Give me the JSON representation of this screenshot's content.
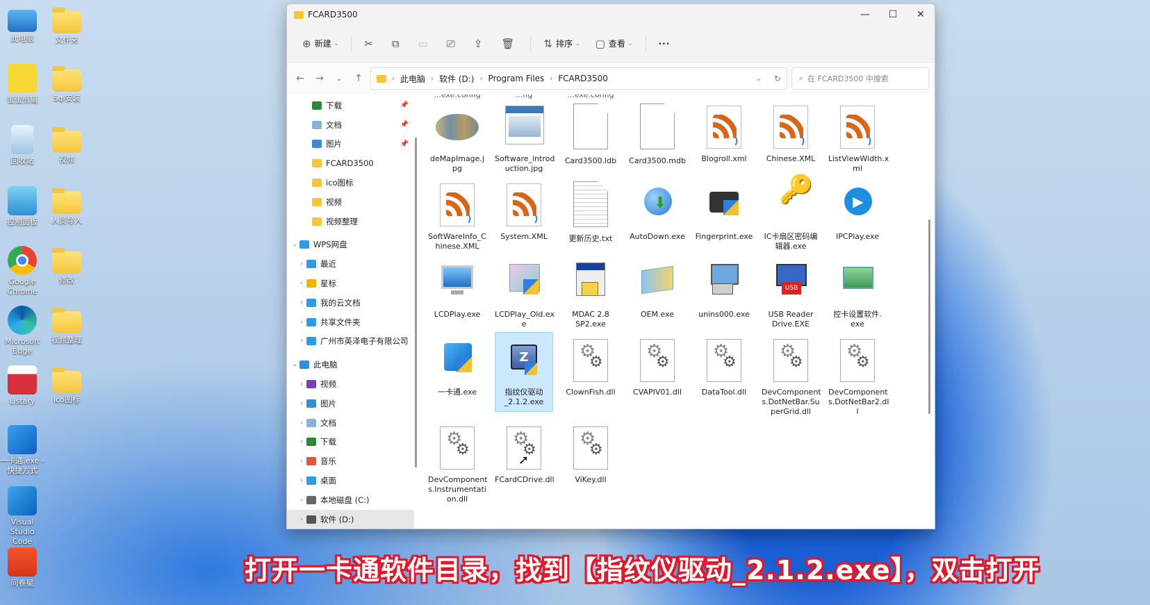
{
  "desktop": {
    "icons": [
      {
        "label": "此电脑"
      },
      {
        "label": "文件夹"
      },
      {
        "label": "蛋蛋剪辑"
      },
      {
        "label": "Sql安装"
      },
      {
        "label": "回收站"
      },
      {
        "label": "视频"
      },
      {
        "label": "控制面板"
      },
      {
        "label": "人员导入"
      },
      {
        "label": "Google Chrome"
      },
      {
        "label": "修改"
      },
      {
        "label": "Microsoft Edge"
      },
      {
        "label": "视频整理"
      },
      {
        "label": "Listary"
      },
      {
        "label": "ico图标"
      },
      {
        "label": "一卡通.exe - 快捷方式"
      },
      {
        "label": "Visual Studio Code"
      },
      {
        "label": "问卷星"
      }
    ]
  },
  "window": {
    "title": "FCARD3500",
    "controls": {
      "minimize": "—",
      "maximize": "☐",
      "close": "✕"
    }
  },
  "toolbar": {
    "new_label": "新建",
    "sort_label": "排序",
    "view_label": "查看",
    "more_label": "···"
  },
  "address": {
    "crumbs": [
      "此电脑",
      "软件 (D:)",
      "Program Files",
      "FCARD3500"
    ]
  },
  "search": {
    "placeholder": "在 FCARD3500 中搜索"
  },
  "sidebar": {
    "items": [
      {
        "label": "下载"
      },
      {
        "label": "文档"
      },
      {
        "label": "图片"
      },
      {
        "label": "FCARD3500"
      },
      {
        "label": "ico图标"
      },
      {
        "label": "视频"
      },
      {
        "label": "视频整理"
      },
      {
        "label": "WPS网盘"
      },
      {
        "label": "最近"
      },
      {
        "label": "星标"
      },
      {
        "label": "我的云文档"
      },
      {
        "label": "共享文件夹"
      },
      {
        "label": "广州市英泽电子有限公司"
      },
      {
        "label": "此电脑"
      },
      {
        "label": "视频"
      },
      {
        "label": "图片"
      },
      {
        "label": "文档"
      },
      {
        "label": "下载"
      },
      {
        "label": "音乐"
      },
      {
        "label": "桌面"
      },
      {
        "label": "本地磁盘 (C:)"
      },
      {
        "label": "软件 (D:)"
      }
    ]
  },
  "files": {
    "partial_top": [
      "...exe.config",
      "...fig",
      "...exe.config"
    ],
    "items": [
      {
        "name": "deMapImage.j pg",
        "kind": "map"
      },
      {
        "name": "Software_introd uction.jpg",
        "kind": "screen"
      },
      {
        "name": "Card3500.ldb",
        "kind": "blank"
      },
      {
        "name": "Card3500.mdb",
        "kind": "blank"
      },
      {
        "name": "Blogroll.xml",
        "kind": "rss"
      },
      {
        "name": "Chinese.XML",
        "kind": "rss"
      },
      {
        "name": "ListViewWidth.x ml",
        "kind": "rss"
      },
      {
        "name": "SoftWareInfo_C hinese.XML",
        "kind": "rss"
      },
      {
        "name": "System.XML",
        "kind": "rss"
      },
      {
        "name": "更新历史.txt",
        "kind": "txt"
      },
      {
        "name": "AutoDown.exe",
        "kind": "globe"
      },
      {
        "name": "Fingerprint.exe",
        "kind": "finger"
      },
      {
        "name": "IC卡扇区密码编 辑器.exe",
        "kind": "keys"
      },
      {
        "name": "IPCPlay.exe",
        "kind": "play"
      },
      {
        "name": "LCDPlay.exe",
        "kind": "monitor"
      },
      {
        "name": "LCDPlay_Old.ex e",
        "kind": "pics"
      },
      {
        "name": "MDAC 2.8 SP2.exe",
        "kind": "setup"
      },
      {
        "name": "OEM.exe",
        "kind": "book"
      },
      {
        "name": "unins000.exe",
        "kind": "uninstall"
      },
      {
        "name": "USB Reader Drive.EXE",
        "kind": "usb"
      },
      {
        "name": "控卡设置软件. exe",
        "kind": "greenpc"
      },
      {
        "name": "一卡通.exe",
        "kind": "winapp"
      },
      {
        "name": "指纹仪驱动 _2.1.2.exe",
        "kind": "driver"
      },
      {
        "name": "ClownFish.dll",
        "kind": "dll"
      },
      {
        "name": "CVAPIV01.dll",
        "kind": "dll"
      },
      {
        "name": "DataTool.dll",
        "kind": "dll"
      },
      {
        "name": "DevComponent s.DotNetBar.Su perGrid.dll",
        "kind": "dll"
      },
      {
        "name": "DevComponent s.DotNetBar2.dl l",
        "kind": "dll"
      },
      {
        "name": "DevComponent s.Instrumentati on.dll",
        "kind": "dll"
      },
      {
        "name": "FCardCDrive.dll",
        "kind": "dll"
      },
      {
        "name": "ViKey.dll",
        "kind": "dll"
      }
    ],
    "selected": "指纹仪驱动 _2.1.2.exe"
  },
  "caption": {
    "text": "打开一卡通软件目录，找到【指纹仪驱动_2.1.2.exe】，双击打开"
  },
  "colors": {
    "accent": "#0067c0",
    "caption_outline": "#e0182c",
    "selection": "#cce8ff"
  }
}
